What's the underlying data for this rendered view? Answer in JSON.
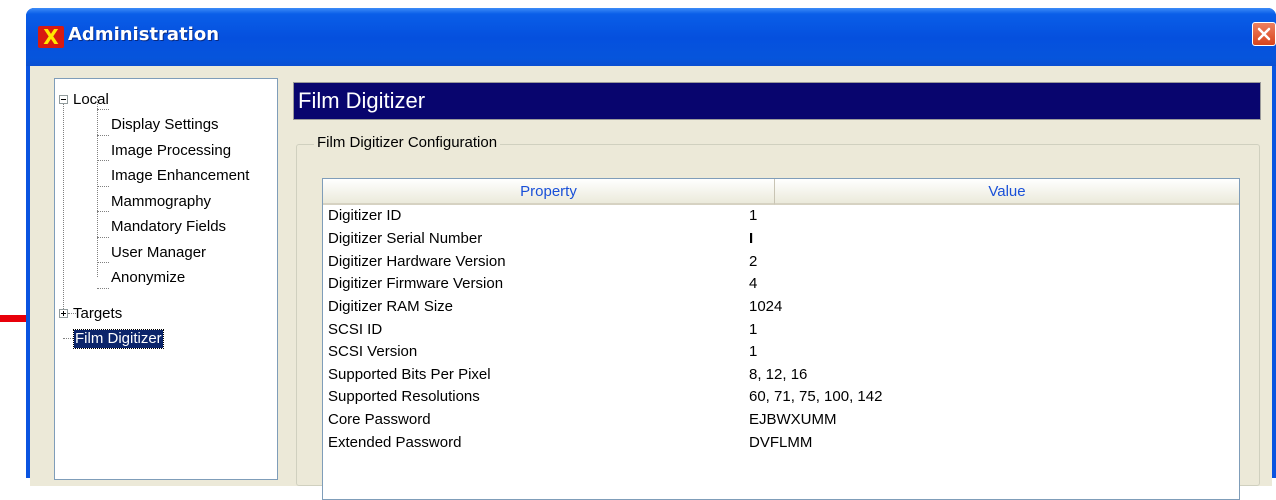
{
  "window": {
    "title": "Administration",
    "app_icon_glyph": "X"
  },
  "tree": {
    "local": {
      "label": "Local",
      "children": [
        "Display Settings",
        "Image Processing",
        "Image Enhancement",
        "Mammography",
        "Mandatory Fields",
        "User Manager",
        "Anonymize"
      ]
    },
    "targets": {
      "label": "Targets"
    },
    "film_digitizer": {
      "label": "Film Digitizer",
      "selected": true
    }
  },
  "panel": {
    "header": "Film Digitizer",
    "group_label": "Film Digitizer Configuration",
    "columns": [
      "Property",
      "Value"
    ],
    "rows": [
      {
        "property": "Digitizer ID",
        "value": "1"
      },
      {
        "property": "Digitizer Serial Number",
        "value": "I"
      },
      {
        "property": "Digitizer Hardware Version",
        "value": "2"
      },
      {
        "property": "Digitizer Firmware Version",
        "value": "4"
      },
      {
        "property": "Digitizer RAM Size",
        "value": "1024"
      },
      {
        "property": "SCSI ID",
        "value": "1"
      },
      {
        "property": "SCSI Version",
        "value": "1"
      },
      {
        "property": "Supported Bits Per Pixel",
        "value": "8, 12, 16"
      },
      {
        "property": "Supported Resolutions",
        "value": "60, 71, 75, 100, 142"
      },
      {
        "property": "Core Password",
        "value": "EJBWXUMM"
      },
      {
        "property": "Extended Password",
        "value": "DVFLMM"
      }
    ]
  },
  "colors": {
    "titlebar": "#0550de",
    "header_bar": "#08056e",
    "selection": "#0b246a",
    "column_header_text": "#1a50d8",
    "annotation_arrow": "#e8000a"
  },
  "icons": {
    "close": "close-icon",
    "tree_collapse": "minus-box-icon",
    "tree_expand": "plus-box-icon",
    "annotation": "red-arrow-icon"
  }
}
